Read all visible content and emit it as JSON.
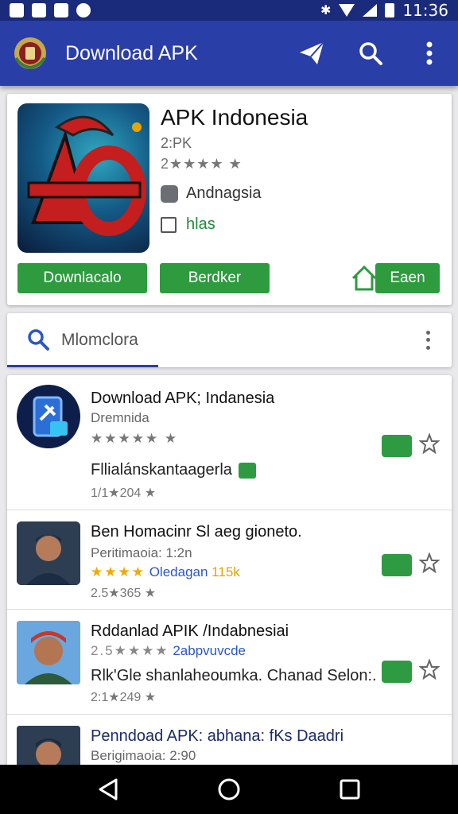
{
  "status_bar": {
    "time": "11:36"
  },
  "appbar": {
    "title": "Download APK"
  },
  "hero": {
    "title": "APK Indonesia",
    "subtitle": "2:PK",
    "rating": "2★★★★ ★",
    "developer": "Andnagsia",
    "check_label": "hlas",
    "button_download": "Downlacalo",
    "button_second": "Berdker",
    "button_third": "Eaen"
  },
  "search": {
    "text": "Mlomclora"
  },
  "list": [
    {
      "title": "Download APK; Indanesia",
      "subtitle": "Dremnida",
      "rating": "★★★★★ ★",
      "extra_title": "Fllialánskantaagerla",
      "meta": "1/1★204 ★"
    },
    {
      "title": "Ben Homacinr Sl aeg gioneto.",
      "subtitle": "Peritimaoia: 1:2n",
      "rating_stars": "★★★★",
      "rating_link": "Oledagan",
      "rating_pct": "115k",
      "meta": "2.5★365 ★"
    },
    {
      "title": "Rddanlad APIK /Indabnesiai",
      "subtitle_prefix": "2.5★★★★",
      "subtitle_link": "2abpvuvcde",
      "extra_title": "Rlk'Gle shanlaheoumka. Chanad Selon:.",
      "meta": "2:1★249 ★"
    },
    {
      "title": "Penndoad APK: abhana: fKs Daadri",
      "subtitle": "Berigimaoia: 2:90"
    }
  ],
  "colors": {
    "appbar": "#2a3ea8",
    "statusbar": "#1b2b7c",
    "button_green": "#2d9b3e",
    "accent_blue": "#2a57c8"
  }
}
